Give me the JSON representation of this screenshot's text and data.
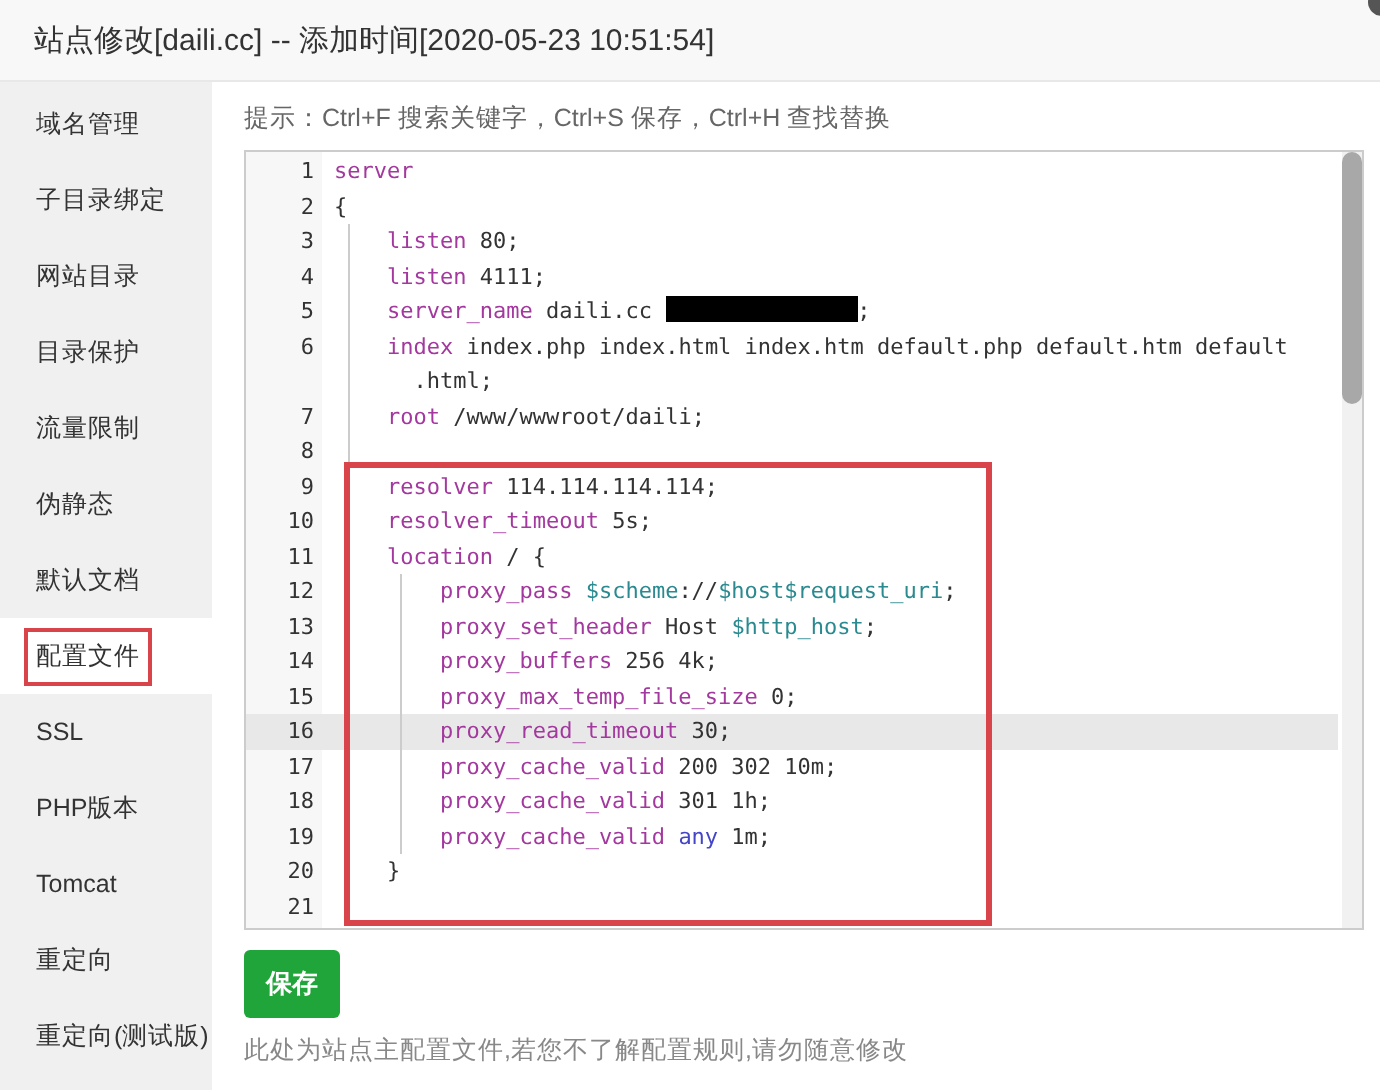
{
  "window": {
    "title": "站点修改[daili.cc] -- 添加时间[2020-05-23 10:51:54]"
  },
  "sidebar": {
    "items": [
      {
        "label": "域名管理",
        "selected": false,
        "highlighted": false
      },
      {
        "label": "子目录绑定",
        "selected": false,
        "highlighted": false
      },
      {
        "label": "网站目录",
        "selected": false,
        "highlighted": false
      },
      {
        "label": "目录保护",
        "selected": false,
        "highlighted": false
      },
      {
        "label": "流量限制",
        "selected": false,
        "highlighted": false
      },
      {
        "label": "伪静态",
        "selected": false,
        "highlighted": false
      },
      {
        "label": "默认文档",
        "selected": false,
        "highlighted": false
      },
      {
        "label": "配置文件",
        "selected": true,
        "highlighted": true
      },
      {
        "label": "SSL",
        "selected": false,
        "highlighted": false
      },
      {
        "label": "PHP版本",
        "selected": false,
        "highlighted": false
      },
      {
        "label": "Tomcat",
        "selected": false,
        "highlighted": false
      },
      {
        "label": "重定向",
        "selected": false,
        "highlighted": false
      },
      {
        "label": "重定向(测试版)",
        "selected": false,
        "highlighted": false
      }
    ]
  },
  "hint": "提示：Ctrl+F 搜索关键字，Ctrl+S 保存，Ctrl+H 查找替换",
  "editor": {
    "lines": [
      {
        "number": "1",
        "active": false,
        "segments": [
          {
            "kind": "keyword",
            "text": "server"
          }
        ]
      },
      {
        "number": "2",
        "active": false,
        "segments": [
          {
            "kind": "plain",
            "text": "{"
          }
        ]
      },
      {
        "number": "3",
        "active": false,
        "segments": [
          {
            "kind": "indent"
          },
          {
            "kind": "keyword",
            "text": "listen"
          },
          {
            "kind": "plain",
            "text": " 80;"
          }
        ]
      },
      {
        "number": "4",
        "active": false,
        "segments": [
          {
            "kind": "indent"
          },
          {
            "kind": "keyword",
            "text": "listen"
          },
          {
            "kind": "plain",
            "text": " 4111;"
          }
        ]
      },
      {
        "number": "5",
        "active": false,
        "segments": [
          {
            "kind": "indent"
          },
          {
            "kind": "keyword",
            "text": "server_name"
          },
          {
            "kind": "plain",
            "text": " daili.cc "
          },
          {
            "kind": "redacted"
          },
          {
            "kind": "plain",
            "text": ";"
          }
        ]
      },
      {
        "number": "6",
        "active": false,
        "segments": [
          {
            "kind": "indent"
          },
          {
            "kind": "keyword",
            "text": "index"
          },
          {
            "kind": "plain",
            "text": " index.php index.html index.htm default.php default.htm default .html;"
          }
        ]
      },
      {
        "number": "7",
        "active": false,
        "segments": [
          {
            "kind": "indent"
          },
          {
            "kind": "keyword",
            "text": "root"
          },
          {
            "kind": "plain",
            "text": " /www/wwwroot/daili;"
          }
        ]
      },
      {
        "number": "8",
        "active": false,
        "segments": [
          {
            "kind": "indent"
          }
        ]
      }
    ],
    "annotation_box": {
      "lines": [
        {
          "number": "9",
          "active": false,
          "segments": [
            {
              "kind": "indent"
            },
            {
              "kind": "keyword",
              "text": "resolver"
            },
            {
              "kind": "plain",
              "text": " 114.114.114.114;"
            }
          ]
        },
        {
          "number": "10",
          "active": false,
          "segments": [
            {
              "kind": "indent"
            },
            {
              "kind": "keyword",
              "text": "resolver_timeout"
            },
            {
              "kind": "plain",
              "text": " 5s;"
            }
          ]
        },
        {
          "number": "11",
          "active": false,
          "segments": [
            {
              "kind": "indent"
            },
            {
              "kind": "keyword",
              "text": "location"
            },
            {
              "kind": "plain",
              "text": " / {"
            }
          ]
        },
        {
          "number": "12",
          "active": false,
          "segments": [
            {
              "kind": "indent"
            },
            {
              "kind": "indent"
            },
            {
              "kind": "keyword",
              "text": "proxy_pass "
            },
            {
              "kind": "variable",
              "text": "$scheme"
            },
            {
              "kind": "plain",
              "text": "://"
            },
            {
              "kind": "variable",
              "text": "$host$request_uri"
            },
            {
              "kind": "plain",
              "text": ";"
            }
          ]
        },
        {
          "number": "13",
          "active": false,
          "segments": [
            {
              "kind": "indent"
            },
            {
              "kind": "indent"
            },
            {
              "kind": "keyword",
              "text": "proxy_set_header"
            },
            {
              "kind": "plain",
              "text": " Host "
            },
            {
              "kind": "variable",
              "text": "$http_host"
            },
            {
              "kind": "plain",
              "text": ";"
            }
          ]
        },
        {
          "number": "14",
          "active": false,
          "segments": [
            {
              "kind": "indent"
            },
            {
              "kind": "indent"
            },
            {
              "kind": "keyword",
              "text": "proxy_buffers"
            },
            {
              "kind": "plain",
              "text": " 256 4k;"
            }
          ]
        },
        {
          "number": "15",
          "active": false,
          "segments": [
            {
              "kind": "indent"
            },
            {
              "kind": "indent"
            },
            {
              "kind": "keyword",
              "text": "proxy_max_temp_file_size"
            },
            {
              "kind": "plain",
              "text": " 0;"
            }
          ]
        },
        {
          "number": "16",
          "active": true,
          "segments": [
            {
              "kind": "indent"
            },
            {
              "kind": "indent"
            },
            {
              "kind": "keyword",
              "text": "proxy_read_timeout"
            },
            {
              "kind": "plain",
              "text": " 30;"
            }
          ]
        },
        {
          "number": "17",
          "active": false,
          "segments": [
            {
              "kind": "indent"
            },
            {
              "kind": "indent"
            },
            {
              "kind": "keyword",
              "text": "proxy_cache_valid"
            },
            {
              "kind": "plain",
              "text": " 200 302 10m;"
            }
          ]
        },
        {
          "number": "18",
          "active": false,
          "segments": [
            {
              "kind": "indent"
            },
            {
              "kind": "indent"
            },
            {
              "kind": "keyword",
              "text": "proxy_cache_valid"
            },
            {
              "kind": "plain",
              "text": " 301 1h;"
            }
          ]
        },
        {
          "number": "19",
          "active": false,
          "segments": [
            {
              "kind": "indent"
            },
            {
              "kind": "indent"
            },
            {
              "kind": "keyword",
              "text": "proxy_cache_valid "
            },
            {
              "kind": "atom",
              "text": "any"
            },
            {
              "kind": "plain",
              "text": " 1m;"
            }
          ]
        },
        {
          "number": "20",
          "active": false,
          "segments": [
            {
              "kind": "indent"
            },
            {
              "kind": "plain",
              "text": "}"
            }
          ]
        },
        {
          "number": "21",
          "active": false
        }
      ]
    }
  },
  "save_button": "保存",
  "note": "此处为站点主配置文件,若您不了解配置规则,请勿随意修改"
}
